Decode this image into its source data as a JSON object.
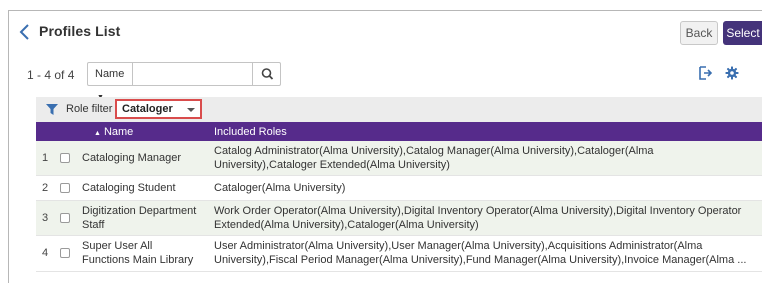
{
  "header": {
    "title": "Profiles List",
    "back_label": "Back",
    "select_label": "Select"
  },
  "toolbar": {
    "count": "1 - 4 of 4",
    "search_scope": "Name",
    "search_placeholder": "",
    "icons": [
      "search-icon",
      "export-icon",
      "gear-icon"
    ]
  },
  "filter": {
    "label": "Role filter :",
    "value": "Cataloger"
  },
  "table": {
    "columns": [
      "",
      "",
      "Name",
      "Included Roles"
    ],
    "rows": [
      {
        "num": "1",
        "name": "Cataloging Manager",
        "roles": "Catalog Administrator(Alma University),Catalog Manager(Alma University),Cataloger(Alma University),Cataloger Extended(Alma University)"
      },
      {
        "num": "2",
        "name": "Cataloging Student",
        "roles": "Cataloger(Alma University)"
      },
      {
        "num": "3",
        "name": "Digitization Department Staff",
        "roles": "Work Order Operator(Alma University),Digital Inventory Operator(Alma University),Digital Inventory Operator Extended(Alma University),Cataloger(Alma University)"
      },
      {
        "num": "4",
        "name": "Super User All Functions Main Library",
        "roles": "User Administrator(Alma University),User Manager(Alma University),Acquisitions Administrator(Alma University),Fiscal Period Manager(Alma University),Fund Manager(Alma University),Invoice Manager(Alma ..."
      }
    ]
  },
  "colors": {
    "accent": "#44337a",
    "table_header": "#562b8b",
    "link_blue": "#3a6fb0",
    "highlight_border": "#d94c4c"
  }
}
